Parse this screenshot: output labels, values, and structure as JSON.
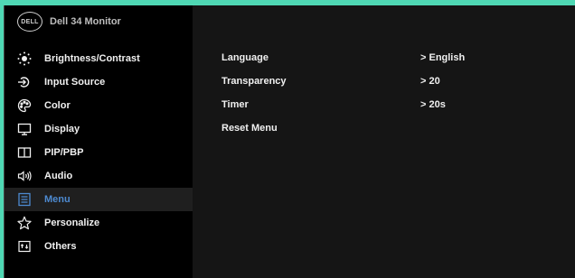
{
  "header": {
    "logo_text": "DELL",
    "title": "Dell 34 Monitor"
  },
  "sidebar": {
    "items": [
      {
        "label": "Brightness/Contrast",
        "icon": "brightness-icon"
      },
      {
        "label": "Input Source",
        "icon": "input-source-icon"
      },
      {
        "label": "Color",
        "icon": "color-palette-icon"
      },
      {
        "label": "Display",
        "icon": "display-icon"
      },
      {
        "label": "PIP/PBP",
        "icon": "pip-pbp-icon"
      },
      {
        "label": "Audio",
        "icon": "speaker-icon"
      },
      {
        "label": "Menu",
        "icon": "menu-icon",
        "active": true
      },
      {
        "label": "Personalize",
        "icon": "star-icon"
      },
      {
        "label": "Others",
        "icon": "others-icon"
      }
    ]
  },
  "content": {
    "rows": [
      {
        "label": "Language",
        "value": "> English"
      },
      {
        "label": "Transparency",
        "value": "> 20"
      },
      {
        "label": "Timer",
        "value": "> 20s"
      },
      {
        "label": "Reset Menu",
        "value": ""
      }
    ]
  },
  "colors": {
    "accent": "#4d8ad0",
    "frame": "#4fd8b4",
    "sidebar_bg": "#000000",
    "panel_bg": "#151515"
  }
}
